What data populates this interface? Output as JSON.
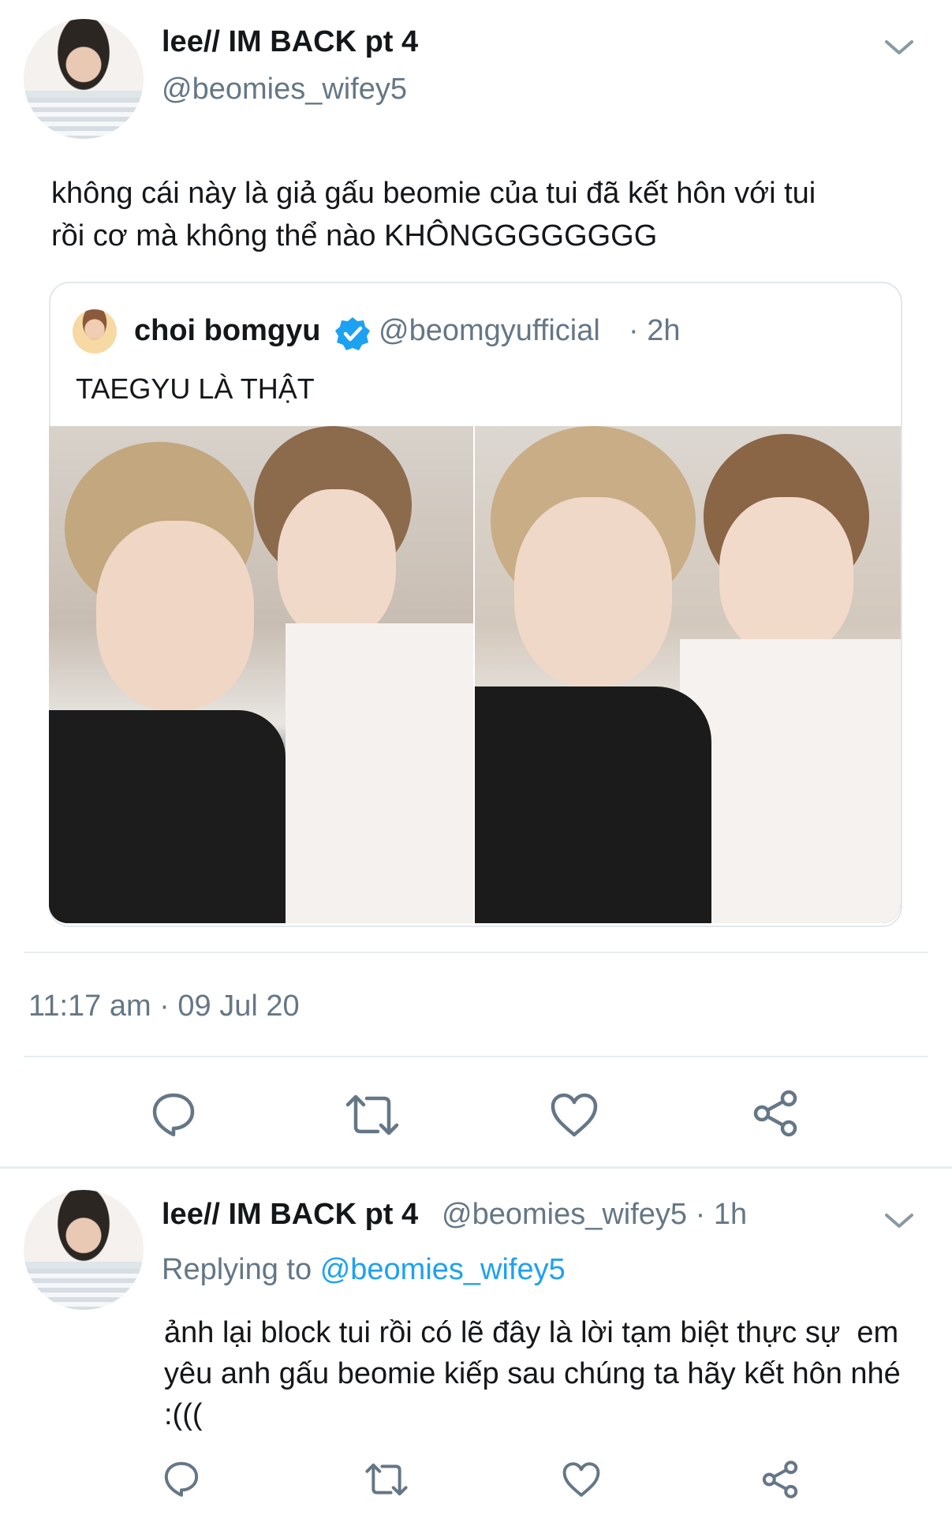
{
  "main_tweet": {
    "display_name": "lee// IM BACK pt 4",
    "handle": "@beomies_wifey5",
    "text_line1": "không cái này là giả gấu beomie của tui đã kết hôn với tui",
    "text_line2": "rồi cơ mà không thể nào KHÔNGGGGGGGG",
    "timestamp": "11:17 am · 09 Jul 20"
  },
  "quoted_tweet": {
    "display_name": "choi bomgyu",
    "handle": "@beomgyufficial",
    "time": "· 2h",
    "text": "TAEGYU LÀ THẬT"
  },
  "reply_tweet": {
    "display_name": "lee// IM BACK pt 4",
    "handle_time": "@beomies_wifey5 · 1h",
    "replying_prefix": "Replying to",
    "replying_handle": "@beomies_wifey5",
    "text_line1": "ảnh lại block tui rồi có lẽ đây là lời tạm biệt thực sự  em",
    "text_line2": "yêu anh gấu beomie kiếp sau chúng ta hãy kết hôn nhé",
    "text_line3": ":((("
  },
  "icons": [
    "chevron-down-icon",
    "verified-badge-icon",
    "reply-icon",
    "retweet-icon",
    "like-icon",
    "share-icon"
  ],
  "colors": {
    "link": "#1da1f2",
    "secondary_text": "#657786",
    "divider": "#e6ecf0"
  }
}
